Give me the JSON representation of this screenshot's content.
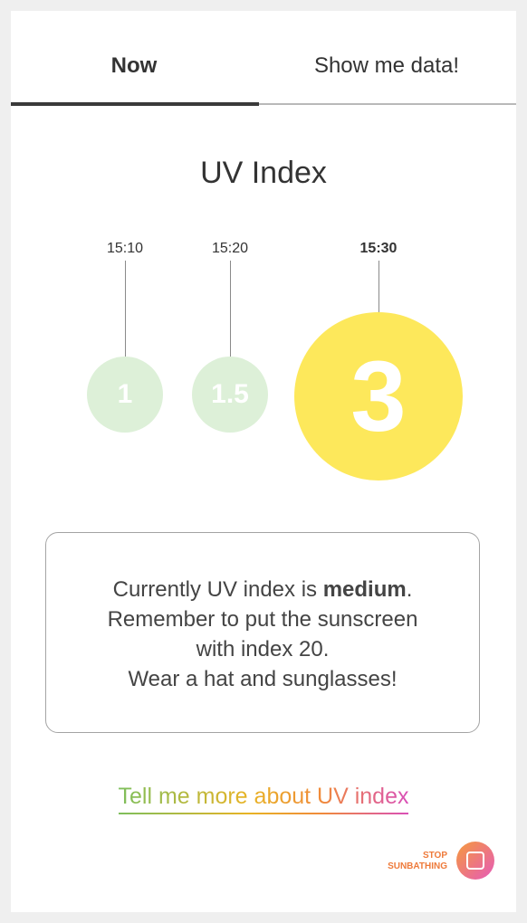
{
  "tabs": [
    {
      "label": "Now",
      "active": true
    },
    {
      "label": "Show me data!",
      "active": false
    }
  ],
  "title": "UV Index",
  "readings": [
    {
      "time": "15:10",
      "value": "1",
      "current": false
    },
    {
      "time": "15:20",
      "value": "1.5",
      "current": false
    },
    {
      "time": "15:30",
      "value": "3",
      "current": true
    }
  ],
  "message": {
    "prefix": "Currently UV index is ",
    "level": "medium",
    "suffix": ".",
    "line2": "Remember to put the sunscreen",
    "line3": "with index 20.",
    "line4": "Wear a hat and sunglasses!"
  },
  "link_text": "Tell me more about UV index",
  "stop": {
    "line1": "STOP",
    "line2": "SUNBATHING",
    "icon": "stop-square-icon"
  },
  "colors": {
    "low": "#ddf0d8",
    "medium": "#fde85b",
    "stop_gradient_start": "#f59a3c",
    "stop_gradient_end": "#e65ab9"
  }
}
